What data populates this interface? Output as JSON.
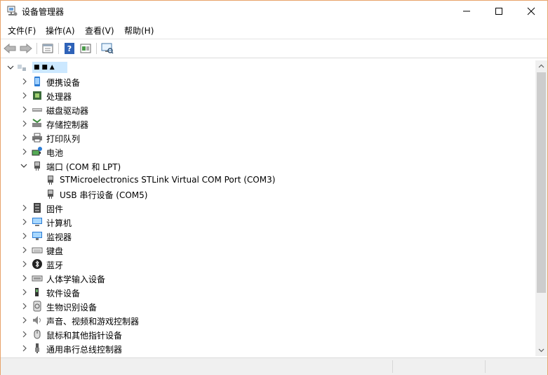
{
  "window": {
    "title": "设备管理器"
  },
  "menu": [
    "文件(F)",
    "操作(A)",
    "查看(V)",
    "帮助(H)"
  ],
  "toolbar": [
    "back-arrow-icon",
    "forward-arrow-icon",
    "properties-icon",
    "help-icon",
    "update-driver-icon",
    "scan-hardware-icon"
  ],
  "tree": {
    "root_label": "■ ■ ▲",
    "items": [
      {
        "label": "便携设备",
        "icon": "portable-device-icon",
        "expanded": false
      },
      {
        "label": "处理器",
        "icon": "processor-icon",
        "expanded": false
      },
      {
        "label": "磁盘驱动器",
        "icon": "disk-drive-icon",
        "expanded": false
      },
      {
        "label": "存储控制器",
        "icon": "storage-controller-icon",
        "expanded": false
      },
      {
        "label": "打印队列",
        "icon": "printer-icon",
        "expanded": false
      },
      {
        "label": "电池",
        "icon": "battery-icon",
        "expanded": false
      },
      {
        "label": "端口 (COM 和 LPT)",
        "icon": "port-icon",
        "expanded": true,
        "children": [
          {
            "label": "STMicroelectronics STLink Virtual COM Port (COM3)",
            "icon": "port-icon"
          },
          {
            "label": "USB 串行设备 (COM5)",
            "icon": "port-icon"
          }
        ]
      },
      {
        "label": "固件",
        "icon": "firmware-icon",
        "expanded": false
      },
      {
        "label": "计算机",
        "icon": "computer-icon",
        "expanded": false
      },
      {
        "label": "监视器",
        "icon": "monitor-icon",
        "expanded": false
      },
      {
        "label": "键盘",
        "icon": "keyboard-icon",
        "expanded": false
      },
      {
        "label": "蓝牙",
        "icon": "bluetooth-icon",
        "expanded": false
      },
      {
        "label": "人体学输入设备",
        "icon": "hid-icon",
        "expanded": false
      },
      {
        "label": "软件设备",
        "icon": "software-device-icon",
        "expanded": false
      },
      {
        "label": "生物识别设备",
        "icon": "biometric-icon",
        "expanded": false
      },
      {
        "label": "声音、视频和游戏控制器",
        "icon": "sound-icon",
        "expanded": false
      },
      {
        "label": "鼠标和其他指针设备",
        "icon": "mouse-icon",
        "expanded": false
      },
      {
        "label": "通用串行总线控制器",
        "icon": "usb-icon",
        "expanded": false
      }
    ]
  },
  "colors": {
    "border": "#e8a36a",
    "selected": "#cce8ff",
    "chrome": "#f0f0f0"
  }
}
